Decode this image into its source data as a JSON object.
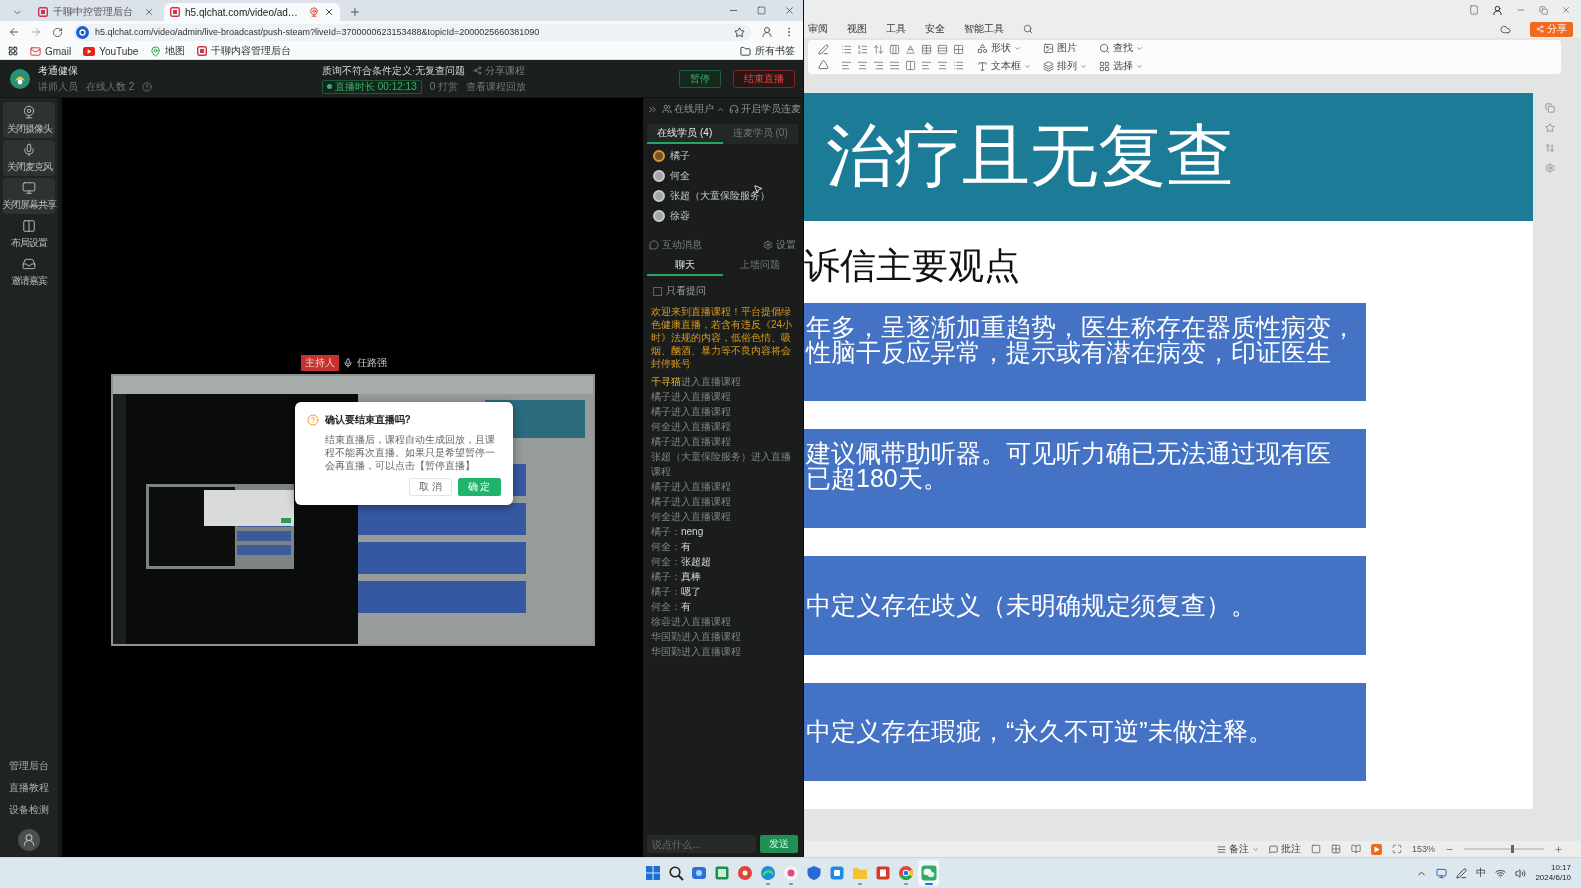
{
  "browser": {
    "tabs": [
      {
        "title": "千聊中控管理后台",
        "selected": false,
        "recording": false
      },
      {
        "title": "h5.qlchat.com/video/ad…",
        "selected": true,
        "recording": true
      }
    ],
    "address": "h5.qlchat.com/video/admin/live-broadcast/push-steam?liveId=3700000623153488&topicId=2000025660381090",
    "bookmarks": [
      "Gmail",
      "YouTube",
      "地图",
      "千聊内容管理后台"
    ],
    "all_bookmarks": "所有书签"
  },
  "live": {
    "header": {
      "name": "考通健保",
      "meta": [
        "讲师人员",
        "在线人数 2"
      ],
      "title": "质询不符合条件定义·无复查问题",
      "share": "分享课程",
      "status": "直播时长 00:12:13",
      "stats": [
        "0 打赏",
        "查看课程回放"
      ],
      "buttons": [
        {
          "label": "暂停",
          "kind": "pause"
        },
        {
          "label": "结束直播",
          "kind": "end"
        }
      ]
    },
    "sidebar": {
      "tools": [
        {
          "label": "关闭摄像头",
          "active": true
        },
        {
          "label": "关闭麦克风",
          "active": true
        },
        {
          "label": "关闭屏幕共享",
          "active": true
        },
        {
          "label": "布局设置",
          "active": false
        },
        {
          "label": "邀请嘉宾",
          "active": false
        }
      ],
      "links": [
        "管理后台",
        "直播教程",
        "设备检测"
      ]
    },
    "stage": {
      "host_badge": "主持人",
      "host_name": "任路强",
      "dialog": {
        "title": "确认要结束直播吗?",
        "message": "结束直播后，课程自动生成回放，且课程不能再次直播。如果只是希望暂停一会再直播，可以点击【暂停直播】",
        "buttons": [
          {
            "label": "取 消",
            "kind": "cancel"
          },
          {
            "label": "确 定",
            "kind": "confirm"
          }
        ]
      }
    },
    "panel": {
      "online": "在线用户",
      "connect": "开启学员连麦",
      "member_tabs": [
        {
          "label": "在线学员 (4)",
          "selected": true
        },
        {
          "label": "连麦学员 (0)",
          "selected": false
        }
      ],
      "members": [
        {
          "name": "橘子",
          "kind": "photo"
        },
        {
          "name": "何全",
          "kind": "default"
        },
        {
          "name": "张超（大童保险服务）",
          "kind": "default"
        },
        {
          "name": "徐蓉",
          "kind": "default"
        }
      ],
      "messages_label": "互动消息",
      "settings": "设置",
      "chat_tabs": [
        {
          "label": "聊天",
          "selected": true
        },
        {
          "label": "上墙问题",
          "selected": false
        }
      ],
      "filter": {
        "label": "只看提问",
        "checked": false
      },
      "notice": "欢迎来到直播课程！平台提倡绿色健康直播，若含有违反《24小时》法规的内容，低俗色情、吸烟、酗酒、暴力等不良内容将会封停账号",
      "messages": [
        {
          "kind": "join",
          "user": "千寻猫",
          "text": "进入直播课程",
          "highlight": true
        },
        {
          "kind": "join",
          "user": "橘子",
          "text": "进入直播课程",
          "highlight": false
        },
        {
          "kind": "join",
          "user": "橘子",
          "text": "进入直播课程",
          "highlight": false
        },
        {
          "kind": "join",
          "user": "何全",
          "text": "进入直播课程",
          "highlight": false
        },
        {
          "kind": "join",
          "user": "橘子",
          "text": "进入直播课程",
          "highlight": false
        },
        {
          "kind": "join",
          "user": "张超（大童保险服务）",
          "text": "进入直播课程",
          "highlight": false
        },
        {
          "kind": "join",
          "user": "橘子",
          "text": "进入直播课程",
          "highlight": false
        },
        {
          "kind": "join",
          "user": "橘子",
          "text": "进入直播课程",
          "highlight": false
        },
        {
          "kind": "join",
          "user": "何全",
          "text": "进入直播课程",
          "highlight": false
        },
        {
          "kind": "chat",
          "user": "橘子：",
          "text": "neng",
          "highlight": false
        },
        {
          "kind": "chat",
          "user": "何全：",
          "text": "有",
          "highlight": false
        },
        {
          "kind": "chat",
          "user": "何全：",
          "text": "张超超",
          "highlight": false
        },
        {
          "kind": "chat",
          "user": "橘子：",
          "text": "真棒",
          "highlight": false
        },
        {
          "kind": "chat",
          "user": "橘子：",
          "text": "嗯了",
          "highlight": false
        },
        {
          "kind": "chat",
          "user": "何全：",
          "text": "有",
          "highlight": false
        },
        {
          "kind": "join",
          "user": "徐蓉",
          "text": "进入直播课程",
          "highlight": false
        },
        {
          "kind": "join",
          "user": "华国勤",
          "text": "进入直播课程",
          "highlight": false
        },
        {
          "kind": "join",
          "user": "华国勤",
          "text": "进入直播课程",
          "highlight": false
        }
      ],
      "input": {
        "placeholder": "说点什么...",
        "send": "发送"
      }
    }
  },
  "presentation": {
    "menu": [
      "审阅",
      "视图",
      "工具",
      "安全",
      "智能工具"
    ],
    "share": "分享",
    "ribbon": [
      "形状",
      "文本框",
      "图片",
      "排列",
      "查找",
      "选择"
    ],
    "slide": {
      "title": "治疗且无复查",
      "subtitle": "诉信主要观点",
      "points": [
        {
          "lines": [
            "年多，呈逐渐加重趋势，医生称存在器质性病变，",
            "性脑干反应异常，提示或有潜在病变，印证医生"
          ]
        },
        {
          "lines": [
            "建议佩带助听器。可见听力确已无法通过现有医",
            "已超180天。"
          ]
        },
        {
          "lines": [
            "中定义存在歧义（未明确规定须复查）。"
          ]
        },
        {
          "lines": [
            "中定义存在瑕疵，“永久不可逆”未做注释。"
          ]
        }
      ]
    },
    "status": {
      "notes": "备注",
      "comments": "批注",
      "zoom": "153%",
      "zoom_slider": {
        "level": 0.6
      }
    }
  },
  "taskbar": {
    "apps": [
      {
        "running": false,
        "active": false
      },
      {
        "running": false,
        "active": false
      },
      {
        "running": false,
        "active": false
      },
      {
        "running": false,
        "active": false
      },
      {
        "running": false,
        "active": false
      },
      {
        "running": true,
        "active": false
      },
      {
        "running": true,
        "active": false
      },
      {
        "running": false,
        "active": false
      },
      {
        "running": false,
        "active": false
      },
      {
        "running": true,
        "active": false
      },
      {
        "running": false,
        "active": false
      },
      {
        "running": true,
        "active": false
      },
      {
        "running": true,
        "active": true
      }
    ],
    "ime": "中",
    "time": "10:17",
    "date": "2024/6/10"
  }
}
